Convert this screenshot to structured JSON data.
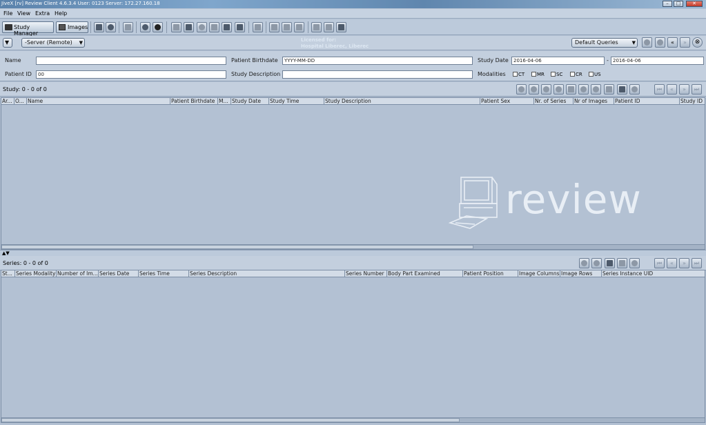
{
  "window": {
    "title": "JiveX [rv] Review Client 4.6.3.4   User: 0123   Server: 172.27.160.18",
    "controls": {
      "minimize": "–",
      "maximize": "□",
      "close": "✕"
    }
  },
  "menu": [
    "File",
    "View",
    "Extra",
    "Help"
  ],
  "toolbar": {
    "study_manager_label": "Study Manager",
    "images_label": "Images"
  },
  "query_bar": {
    "server": "-Server (Remote)",
    "license_line1": "Licensed for:",
    "license_line2": "Hospital Liberec, Liberec",
    "queries": "Default Queries"
  },
  "form": {
    "name_label": "Name",
    "name_value": "",
    "patient_id_label": "Patient ID",
    "patient_id_value": "00",
    "birthdate_label": "Patient Birthdate",
    "birthdate_placeholder": "YYYY-MM-DD",
    "study_desc_label": "Study Description",
    "study_desc_value": "",
    "study_date_label": "Study Date",
    "study_date_from": "2016-04-06",
    "study_date_sep": "-",
    "study_date_to": "2016-04-06",
    "modalities_label": "Modalities",
    "modalities": [
      "CT",
      "MR",
      "SC",
      "CR",
      "US"
    ]
  },
  "study": {
    "count_label": "Study: 0 - 0 of 0",
    "columns": [
      "Ar...",
      "O...",
      "Name",
      "Patient Birthdate",
      "M...",
      "Study Date",
      "Study Time",
      "Study Description",
      "Patient Sex",
      "Nr. of Series",
      "Nr of Images",
      "Patient ID",
      "Study ID"
    ]
  },
  "series": {
    "count_label": "Series: 0 - 0 of 0",
    "columns": [
      "St...",
      "Series Modality",
      "Number of Im...",
      "Series Date",
      "Series Time",
      "Series Description",
      "Series Number",
      "Body Part Examined",
      "Patient Position",
      "Image Columns",
      "Image Rows",
      "Series Instance UID"
    ]
  },
  "watermark": {
    "word": "review"
  },
  "colors": {
    "background": "#b3c1d3",
    "titlebar": "#5a82ab",
    "logo": "#e8eef5"
  }
}
